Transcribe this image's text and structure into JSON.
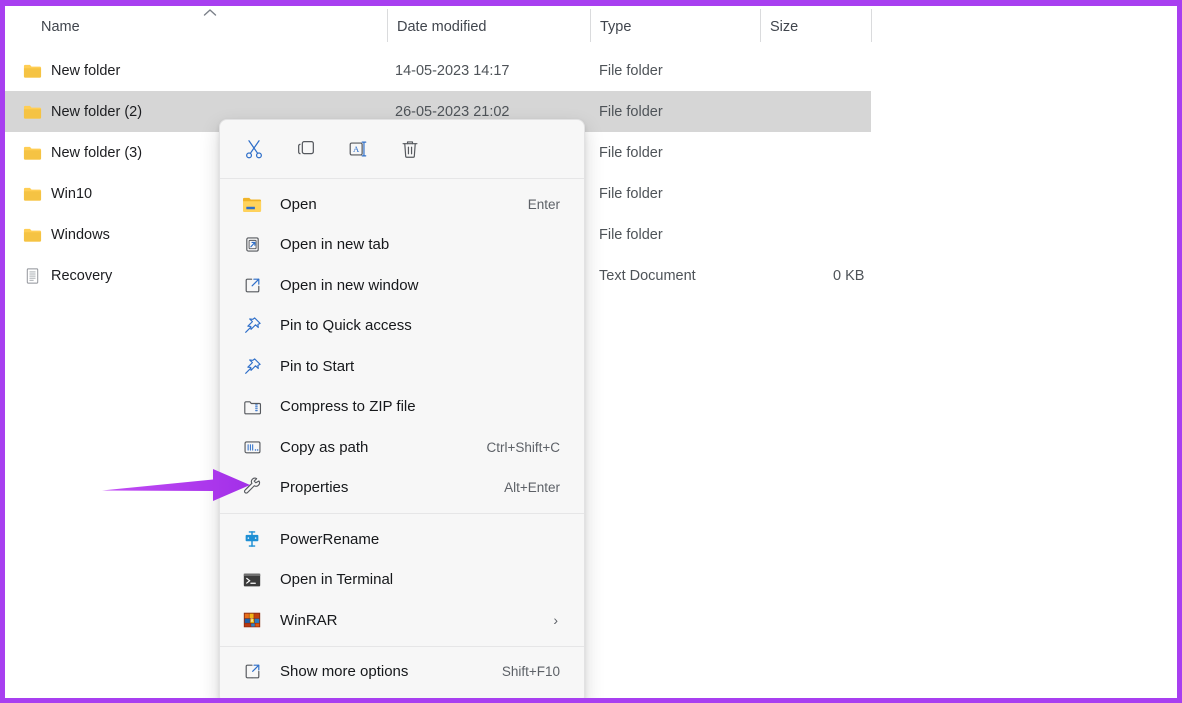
{
  "window": {
    "border_color": "#a83ff0",
    "background": "#ffffff"
  },
  "file_list": {
    "columns": [
      {
        "label": "Name",
        "sort": "ascending"
      },
      {
        "label": "Date modified"
      },
      {
        "label": "Type"
      },
      {
        "label": "Size"
      }
    ],
    "sort_indicator_icon": "chevron-up-icon",
    "rows": [
      {
        "icon": "folder-icon",
        "name": "New folder",
        "date": "14-05-2023 14:17",
        "type": "File folder",
        "size": "",
        "selected": false
      },
      {
        "icon": "folder-icon",
        "name": "New folder (2)",
        "date": "26-05-2023 21:02",
        "type": "File folder",
        "size": "",
        "selected": true
      },
      {
        "icon": "folder-icon",
        "name": "New folder (3)",
        "date": "",
        "type": "File folder",
        "size": "",
        "selected": false
      },
      {
        "icon": "folder-icon",
        "name": "Win10",
        "date": "",
        "type": "File folder",
        "size": "",
        "selected": false
      },
      {
        "icon": "folder-icon",
        "name": "Windows",
        "date": "",
        "type": "File folder",
        "size": "",
        "selected": false
      },
      {
        "icon": "text-file-icon",
        "name": "Recovery",
        "date": "",
        "type": "Text Document",
        "size": "0 KB",
        "selected": false
      }
    ]
  },
  "context_menu": {
    "toolbar": [
      {
        "icon": "cut-icon",
        "label": "Cut"
      },
      {
        "icon": "copy-icon",
        "label": "Copy"
      },
      {
        "icon": "rename-icon",
        "label": "Rename"
      },
      {
        "icon": "delete-icon",
        "label": "Delete"
      }
    ],
    "groups": [
      {
        "items": [
          {
            "icon": "open-folder-icon",
            "label": "Open",
            "accel": "Enter"
          },
          {
            "icon": "open-new-tab-icon",
            "label": "Open in new tab",
            "accel": ""
          },
          {
            "icon": "open-new-window-icon",
            "label": "Open in new window",
            "accel": ""
          },
          {
            "icon": "pin-icon",
            "label": "Pin to Quick access",
            "accel": ""
          },
          {
            "icon": "pin-icon",
            "label": "Pin to Start",
            "accel": ""
          },
          {
            "icon": "zip-folder-icon",
            "label": "Compress to ZIP file",
            "accel": ""
          },
          {
            "icon": "copy-path-icon",
            "label": "Copy as path",
            "accel": "Ctrl+Shift+C"
          },
          {
            "icon": "wrench-icon",
            "label": "Properties",
            "accel": "Alt+Enter"
          }
        ]
      },
      {
        "items": [
          {
            "icon": "powerrename-icon",
            "label": "PowerRename",
            "accel": ""
          },
          {
            "icon": "terminal-icon",
            "label": "Open in Terminal",
            "accel": ""
          },
          {
            "icon": "winrar-icon",
            "label": "WinRAR",
            "accel": "",
            "submenu": true
          }
        ]
      },
      {
        "items": [
          {
            "icon": "show-more-icon",
            "label": "Show more options",
            "accel": "Shift+F10"
          }
        ]
      }
    ]
  },
  "annotation": {
    "arrow": {
      "color_start": "#c24df5",
      "color_end": "#a22fe8",
      "points_to": "Properties"
    }
  }
}
